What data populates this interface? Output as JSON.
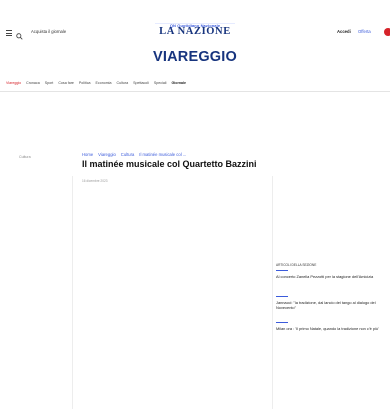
{
  "network": {
    "label": "QN Quotidiano Nazionale"
  },
  "header": {
    "edition_label": "Acquista il giornale",
    "brand": "LA NAZIONE",
    "subscribe": "Accedi",
    "offer": "Offerta"
  },
  "city": "VIAREGGIO",
  "nav": {
    "items": [
      {
        "label": "Viareggio",
        "state": "active"
      },
      {
        "label": "Cronaca",
        "state": "normal"
      },
      {
        "label": "Sport",
        "state": "normal"
      },
      {
        "label": "Cosa fare",
        "state": "normal"
      },
      {
        "label": "Politica",
        "state": "normal"
      },
      {
        "label": "Economia",
        "state": "normal"
      },
      {
        "label": "Cultura",
        "state": "normal"
      },
      {
        "label": "Spettacoli",
        "state": "normal"
      },
      {
        "label": "Speciali",
        "state": "normal"
      },
      {
        "label": "Giornale",
        "state": "bold"
      }
    ]
  },
  "sidebar": {
    "label": "Cultura"
  },
  "breadcrumb": [
    "Home",
    "Viareggio",
    "Cultura",
    "Il matinée musicale col ..."
  ],
  "article": {
    "title": "Il matinée musicale col Quartetto Bazzini",
    "meta": "16 dicembre 2023"
  },
  "related": {
    "heading": "ARTICOLI DELLA SEZIONE",
    "items": [
      "Al concerto Zanella Pezzotti per la stagione dell'Amicizia",
      "Jannacci: \"la tradizione, dal lancio del tango al dialogo del Novecento\"",
      "Milan ora : 'Il primo Natale, quando la tradizione non c'è più'"
    ]
  }
}
